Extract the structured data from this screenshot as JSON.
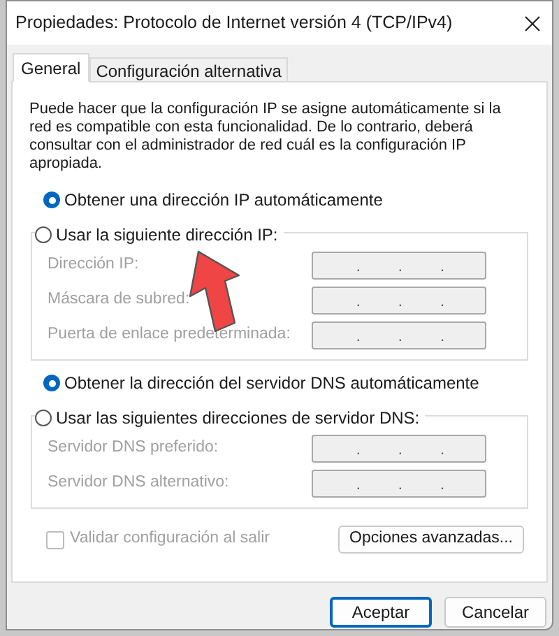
{
  "window": {
    "title": "Propiedades: Protocolo de Internet versión 4 (TCP/IPv4)"
  },
  "tabs": [
    {
      "label": "General",
      "selected": true
    },
    {
      "label": "Configuración alternativa",
      "selected": false
    }
  ],
  "description": "Puede hacer que la configuración IP se asigne automáticamente si la red es compatible con esta funcionalidad. De lo contrario, deberá consultar con el administrador de red cuál es la configuración IP apropiada.",
  "ip_section": {
    "options": [
      {
        "label": "Obtener una dirección IP automáticamente",
        "selected": true
      },
      {
        "label": "Usar la siguiente dirección IP:",
        "selected": false
      }
    ],
    "fields": [
      {
        "label": "Dirección IP:",
        "separators": [
          ".",
          ".",
          "."
        ],
        "disabled": true
      },
      {
        "label": "Máscara de subred:",
        "separators": [
          ".",
          ".",
          "."
        ],
        "disabled": true
      },
      {
        "label": "Puerta de enlace predeterminada:",
        "separators": [
          ".",
          ".",
          "."
        ],
        "disabled": true
      }
    ]
  },
  "dns_section": {
    "options": [
      {
        "label": "Obtener la dirección del servidor DNS automáticamente",
        "selected": true
      },
      {
        "label": "Usar las siguientes direcciones de servidor DNS:",
        "selected": false
      }
    ],
    "fields": [
      {
        "label": "Servidor DNS preferido:",
        "separators": [
          ".",
          ".",
          "."
        ],
        "disabled": true
      },
      {
        "label": "Servidor DNS alternativo:",
        "separators": [
          ".",
          ".",
          "."
        ],
        "disabled": true
      }
    ]
  },
  "validate_checkbox": {
    "label": "Validar configuración al salir",
    "checked": false,
    "disabled": true
  },
  "advanced_button": "Opciones avanzadas...",
  "buttons": [
    {
      "label": "Aceptar",
      "default": true
    },
    {
      "label": "Cancelar",
      "default": false
    }
  ]
}
